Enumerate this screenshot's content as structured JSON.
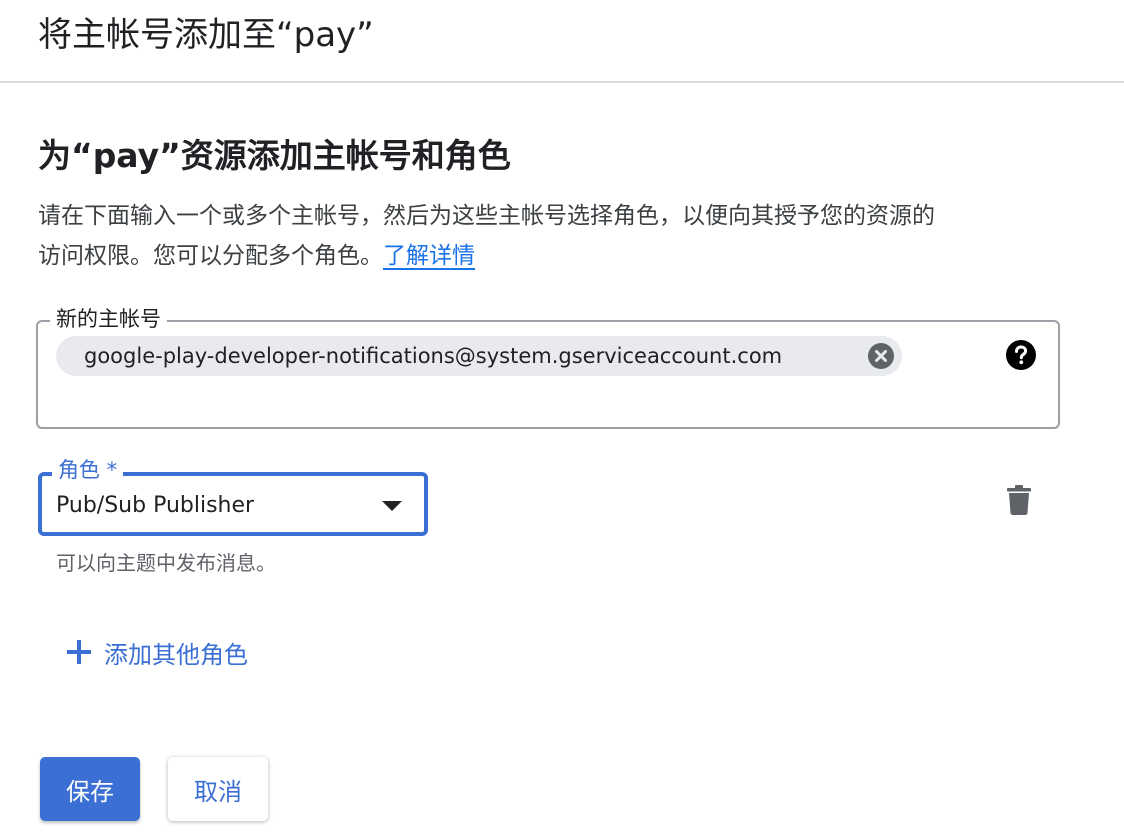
{
  "panel": {
    "title": "将主帐号添加至“pay”"
  },
  "section": {
    "heading": "为“pay”资源添加主帐号和角色",
    "description_line1": "请在下面输入一个或多个主帐号，然后为这些主帐号选择角色，以便向其授予您的资源的",
    "description_line2": "访问权限。您可以分配多个角色。",
    "learn_more": "了解详情"
  },
  "principals": {
    "label": "新的主帐号",
    "chips": [
      {
        "text": "google-play-developer-notifications@system.gserviceaccount.com"
      }
    ],
    "help_icon": "help-circle-icon",
    "remove_icon": "cancel-circle-icon"
  },
  "role": {
    "label": "角色 *",
    "value": "Pub/Sub Publisher",
    "hint": "可以向主题中发布消息。",
    "delete_icon": "trash-icon"
  },
  "add_role": {
    "label": "添加其他角色",
    "icon": "plus-icon"
  },
  "actions": {
    "save_label": "保存",
    "cancel_label": "取消"
  },
  "colors": {
    "accent": "#3b6fd4",
    "chip_bg": "#e8eaed",
    "divider": "#dadce0"
  }
}
